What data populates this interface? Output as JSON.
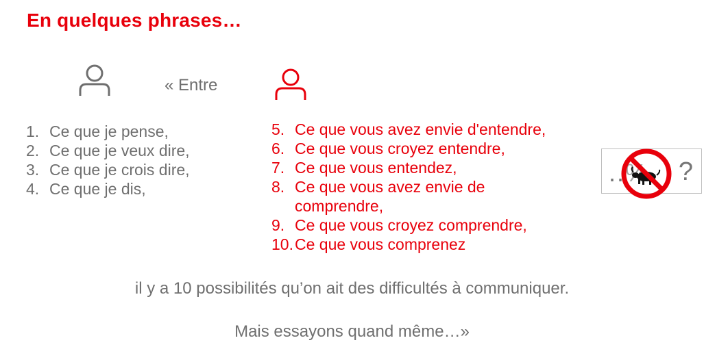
{
  "title": "En quelques phrases…",
  "entre": "« Entre",
  "speaker_icon": "person-icon",
  "listener_icon": "person-icon",
  "speaker_list": [
    {
      "num": "1.",
      "text": "Ce que je pense,"
    },
    {
      "num": "2.",
      "text": "Ce que je veux dire,"
    },
    {
      "num": "3.",
      "text": "Ce que je crois dire,"
    },
    {
      "num": "4.",
      "text": "Ce que je dis,"
    }
  ],
  "listener_list": [
    {
      "num": "5.",
      "text": "Ce que vous avez envie d'entendre,"
    },
    {
      "num": "6.",
      "text": "Ce que vous croyez entendre,"
    },
    {
      "num": "7.",
      "text": "Ce que vous entendez,"
    },
    {
      "num": "8.",
      "text": "Ce que vous avez envie de comprendre,"
    },
    {
      "num": "9.",
      "text": "Ce que vous croyez comprendre,"
    },
    {
      "num": "10.",
      "text": "Ce que vous comprenez"
    }
  ],
  "gesture_box": {
    "symbols": "..%",
    "question": "?",
    "icon": "no-bull-icon"
  },
  "conclusion": "il y a 10 possibilités qu’on ait des difficultés à communiquer.",
  "closing": "Mais essayons quand même…»",
  "colors": {
    "red": "#e8000b",
    "gray": "#6f6f6f"
  }
}
